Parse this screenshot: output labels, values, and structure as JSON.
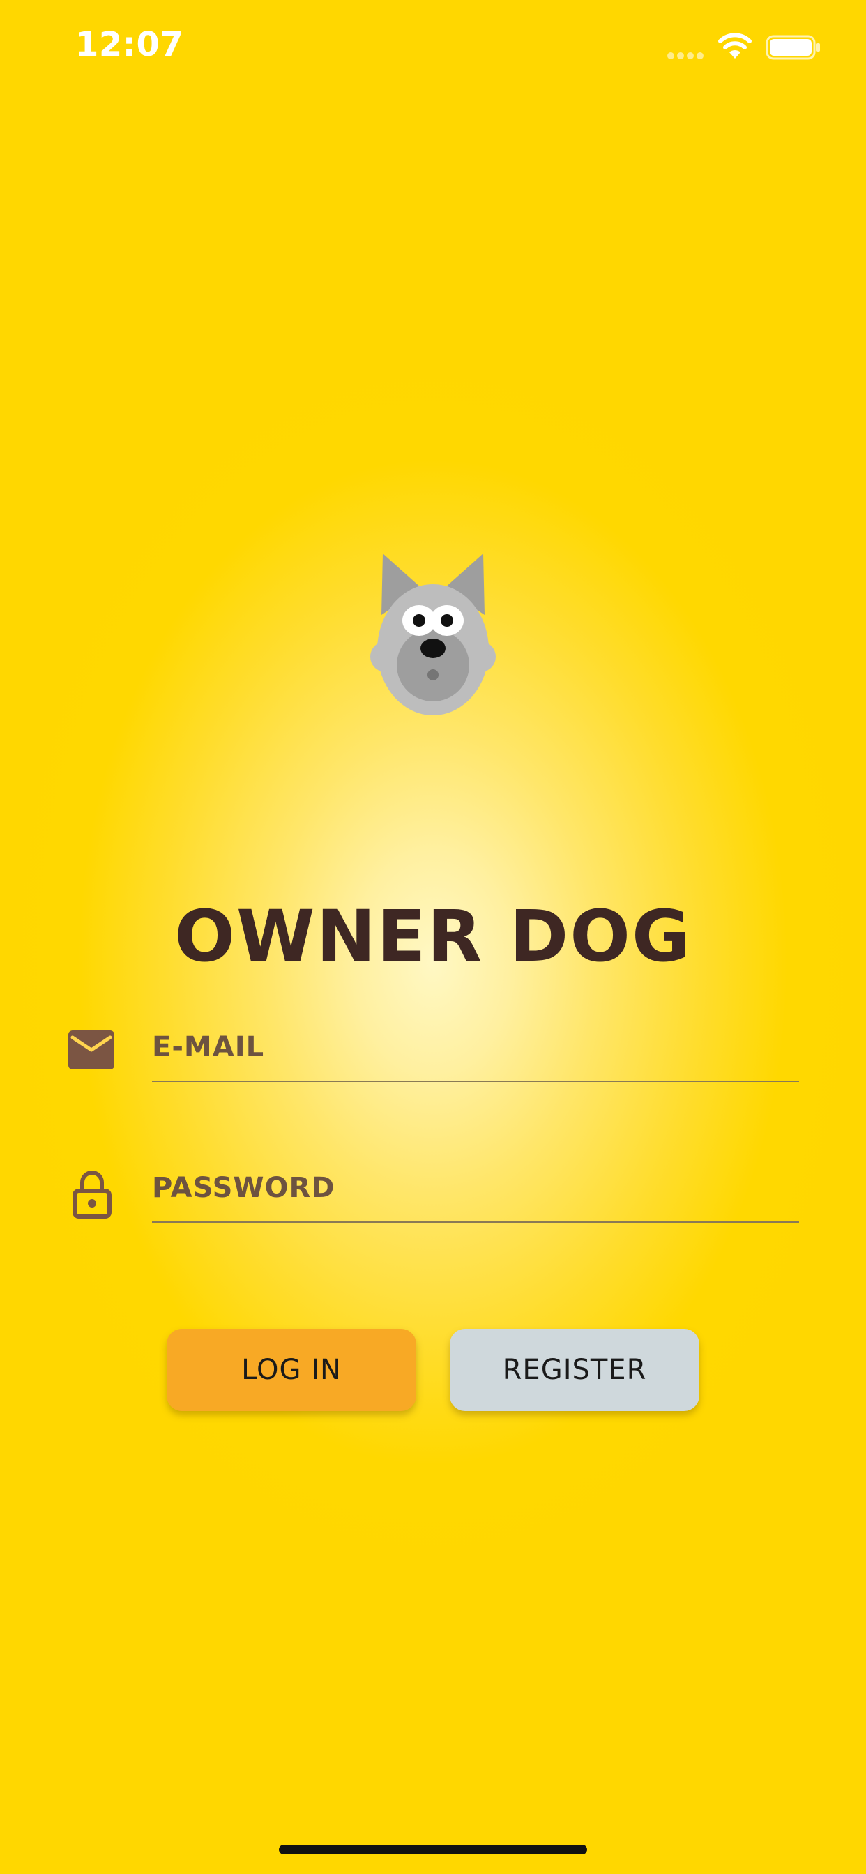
{
  "status_bar": {
    "time": "12:07"
  },
  "app": {
    "title": "OWNER DOG",
    "logo_icon": "dog-face-icon"
  },
  "form": {
    "email": {
      "placeholder": "E-MAIL",
      "value": "",
      "icon": "mail-icon"
    },
    "password": {
      "placeholder": "PASSWORD",
      "value": "",
      "icon": "lock-icon"
    }
  },
  "buttons": {
    "login_label": "LOG IN",
    "register_label": "REGISTER"
  },
  "colors": {
    "background": "#FFD700",
    "title": "#3E2723",
    "icon": "#7B5543",
    "login_button": "#F8A925",
    "register_button": "#CFD8DC"
  }
}
